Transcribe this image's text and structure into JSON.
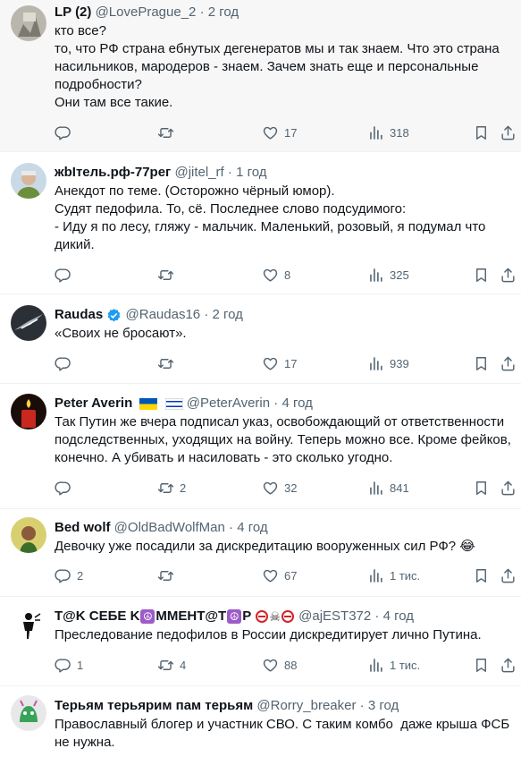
{
  "tweets": [
    {
      "name": "LP (2)",
      "handle": "@LovePrague_2",
      "time": "2 год",
      "text": "кто все?\nто, что РФ страна ебнутых дегенератов мы и так знаем. Что это страна насильников, мародеров - знаем. Зачем знать еще и персональные подробности?\nОни там все такие.",
      "replies": "",
      "retweets": "",
      "likes": "17",
      "views": "318"
    },
    {
      "name": "жbIтель.рф-77рег",
      "handle": "@jitel_rf",
      "time": "1 год",
      "text": "Анекдот по теме. (Осторожно чёрный юмор).\nСудят педофила. То, сё. Последнее слово подсудимого:\n- Иду я по лесу, гляжу - мальчик. Маленький, розовый, я подумал что дикий.",
      "replies": "",
      "retweets": "",
      "likes": "8",
      "views": "325"
    },
    {
      "name": "Raudas",
      "handle": "@Raudas16",
      "time": "2 год",
      "text": "«Своих не бросают».",
      "replies": "",
      "retweets": "",
      "likes": "17",
      "views": "939"
    },
    {
      "name": "Peter Averin",
      "handle": "@PeterAverin",
      "time": "4 год",
      "text": "Так Путин же вчера подписал указ, освобождающий от ответственности подследственных, уходящих на войну. Теперь можно все. Кроме фейков, конечно. А убивать и насиловать - это сколько угодно.",
      "replies": "",
      "retweets": "2",
      "likes": "32",
      "views": "841"
    },
    {
      "name": "Bed wolf",
      "handle": "@OldBadWolfMan",
      "time": "4 год",
      "text": "Девочку уже посадили за дискредитацию вооруженных сил РФ? 😂",
      "replies": "2",
      "retweets": "",
      "likes": "67",
      "views": "1 тис."
    },
    {
      "name_parts": [
        "T@K СЕБЕ K",
        "ММЕНТ@Т",
        "P"
      ],
      "handle": "@ajEST372",
      "time": "4 год",
      "text": "Преследование педофилов в России дискредитирует лично Путина.",
      "replies": "1",
      "retweets": "4",
      "likes": "88",
      "views": "1 тис."
    },
    {
      "name": "Терьям терьярим пам терьям",
      "handle": "@Rorry_breaker",
      "time": "3 год",
      "text": "Православный блогер и участник СВО. С таким комбо  даже крыша ФСБ не нужна."
    }
  ],
  "colors": {
    "text": "#0f1419",
    "secondary": "#536471",
    "verified": "#1d9bf0",
    "divider": "#eff3f4"
  },
  "icons": [
    "reply-icon",
    "retweet-icon",
    "like-icon",
    "views-icon",
    "bookmark-icon",
    "share-icon",
    "verified-badge-icon"
  ]
}
